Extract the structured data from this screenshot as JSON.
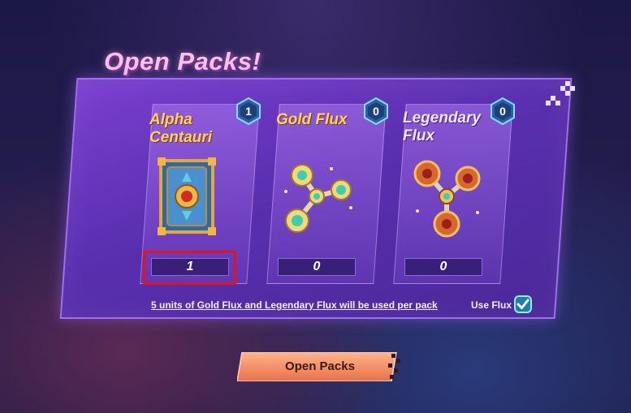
{
  "header": {
    "title": "Open Packs!"
  },
  "packs": [
    {
      "name": "Alpha Centauri",
      "name_line1": "Alpha",
      "name_line2": "Centauri",
      "owned": "1",
      "quantity": "1",
      "icon": "alpha-centauri-pack-icon"
    },
    {
      "name": "Gold Flux",
      "owned": "0",
      "quantity": "0",
      "icon": "gold-flux-icon"
    },
    {
      "name": "Legendary Flux",
      "name_line1": "Legendary",
      "name_line2": "Flux",
      "owned": "0",
      "quantity": "0",
      "icon": "legendary-flux-icon"
    }
  ],
  "footer": {
    "note": "5 units of Gold Flux and Legendary Flux will be used per pack",
    "use_flux_label": "Use Flux",
    "use_flux_checked": true
  },
  "actions": {
    "open_packs_label": "Open Packs"
  },
  "colors": {
    "accent_gold": "#ffd25a",
    "panel": "#5a2fb0",
    "button": "#f08a60",
    "highlight": "#e0141a"
  }
}
